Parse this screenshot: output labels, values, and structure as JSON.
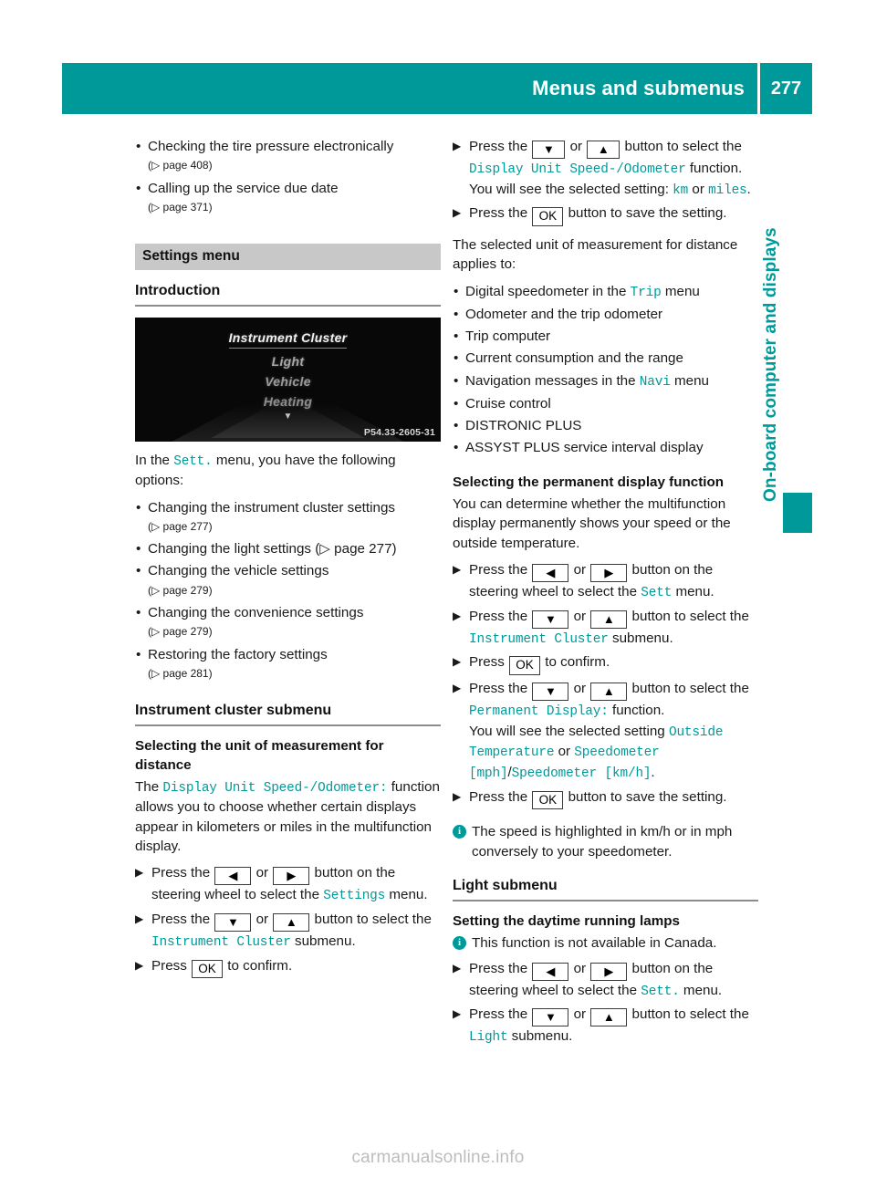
{
  "header": {
    "title": "Menus and submenus",
    "page_number": "277",
    "accent_color": "#009999"
  },
  "side_tab": {
    "label": "On-board computer and displays"
  },
  "watermark": {
    "text": "carmanualsonline.info"
  },
  "left_column": {
    "intro_bullets": [
      {
        "bullet": "•",
        "text": "Checking the tire pressure electronically",
        "ref": "(▷ page 408)"
      },
      {
        "bullet": "•",
        "text": "Calling up the service due date",
        "ref": "(▷ page 371)"
      }
    ],
    "section_band": "Settings menu",
    "introduction_heading": "Introduction",
    "cluster_image": {
      "items": [
        "Instrument Cluster",
        "Light",
        "Vehicle",
        "Heating"
      ],
      "scroll_arrow": "▼",
      "code": "P54.33-2605-31"
    },
    "intro_lead_pre": "In the ",
    "intro_lead_mono": "Sett.",
    "intro_lead_post": " menu, you have the following options:",
    "option_bullets": [
      {
        "bullet": "•",
        "text": "Changing the instrument cluster settings",
        "ref": "(▷ page 277)",
        "inline": false
      },
      {
        "bullet": "•",
        "text": "Changing the light settings (▷ page 277)",
        "ref": "",
        "inline": true
      },
      {
        "bullet": "•",
        "text": "Changing the vehicle settings",
        "ref": "(▷ page 279)",
        "inline": false
      },
      {
        "bullet": "•",
        "text": "Changing the convenience settings",
        "ref": "(▷ page 279)",
        "inline": false
      },
      {
        "bullet": "•",
        "text": "Restoring the factory settings",
        "ref": "(▷ page 281)",
        "inline": false
      }
    ],
    "submenu_heading": "Instrument cluster submenu",
    "unit_heading": "Selecting the unit of measurement for distance",
    "unit_para_pre": "The ",
    "unit_para_mono": "Display Unit Speed-/Odometer:",
    "unit_para_post": " function allows you to choose whether certain displays appear in kilometers or miles in the multifunction display.",
    "steps": [
      {
        "marker": "▶",
        "pre": "Press the ",
        "btn1": "◀",
        "mid": " or ",
        "btn2": "▶",
        "post": " button on the steering wheel to select the ",
        "mono": "Settings",
        "tail": " menu."
      },
      {
        "marker": "▶",
        "pre": "Press the ",
        "btn1": "▼",
        "mid": " or ",
        "btn2": "▲",
        "post": " button to select the ",
        "mono": "Instrument Cluster",
        "tail": " submenu."
      },
      {
        "marker": "▶",
        "pre": "Press ",
        "btn_ok": "OK",
        "post": " to confirm."
      }
    ]
  },
  "right_column": {
    "step_select_display_unit": {
      "marker": "▶",
      "pre": "Press the ",
      "btn1": "▼",
      "mid": " or ",
      "btn2": "▲",
      "post": " button to select the ",
      "mono": "Display Unit Speed-/Odometer",
      "tail": " function.",
      "sub_pre": "You will see the selected setting: ",
      "sub_mono1": "km",
      "sub_mid": " or ",
      "sub_mono2": "miles",
      "sub_tail": "."
    },
    "step_save": {
      "marker": "▶",
      "pre": "Press the ",
      "btn_ok": "OK",
      "post": " button to save the setting."
    },
    "applies_lead": "The selected unit of measurement for distance applies to:",
    "applies_bullets": [
      {
        "bullet": "•",
        "pre": "Digital speedometer in the ",
        "mono": "Trip",
        "post": " menu"
      },
      {
        "bullet": "•",
        "pre": "Odometer and the trip odometer",
        "mono": "",
        "post": ""
      },
      {
        "bullet": "•",
        "pre": "Trip computer",
        "mono": "",
        "post": ""
      },
      {
        "bullet": "•",
        "pre": "Current consumption and the range",
        "mono": "",
        "post": ""
      },
      {
        "bullet": "•",
        "pre": "Navigation messages in the ",
        "mono": "Navi",
        "post": " menu"
      },
      {
        "bullet": "•",
        "pre": "Cruise control",
        "mono": "",
        "post": ""
      },
      {
        "bullet": "•",
        "pre": "DISTRONIC PLUS",
        "mono": "",
        "post": ""
      },
      {
        "bullet": "•",
        "pre": "ASSYST PLUS service interval display",
        "mono": "",
        "post": ""
      }
    ],
    "permanent_heading": "Selecting the permanent display function",
    "permanent_para": "You can determine whether the multifunction display permanently shows your speed or the outside temperature.",
    "permanent_steps": [
      {
        "marker": "▶",
        "pre": "Press the ",
        "btn1": "◀",
        "mid": " or ",
        "btn2": "▶",
        "post": " button on the steering wheel to select the ",
        "mono": "Sett",
        "tail": " menu."
      },
      {
        "marker": "▶",
        "pre": "Press the ",
        "btn1": "▼",
        "mid": " or ",
        "btn2": "▲",
        "post": " button to select the ",
        "mono": "Instrument Cluster",
        "tail": " submenu."
      },
      {
        "marker": "▶",
        "pre": "Press ",
        "btn_ok": "OK",
        "post": " to confirm."
      }
    ],
    "step_permanent_display": {
      "marker": "▶",
      "pre": "Press the ",
      "btn1": "▼",
      "mid": " or ",
      "btn2": "▲",
      "post": " button to select the ",
      "mono": "Permanent Display:",
      "tail": " function.",
      "sub_pre": "You will see the selected setting ",
      "sub_mono1": "Outside Temperature",
      "sub_mid": " or ",
      "sub_mono2": "Speedometer [mph]",
      "sub_slash": "/",
      "sub_mono3": "Speedometer [km/h]",
      "sub_tail": "."
    },
    "step_save2": {
      "marker": "▶",
      "pre": "Press the ",
      "btn_ok": "OK",
      "post": " button to save the setting."
    },
    "note_speed": "The speed is highlighted in km/h or in mph conversely to your speedometer.",
    "light_heading": "Light submenu",
    "daytime_heading": "Setting the daytime running lamps",
    "note_canada": "This function is not available in Canada.",
    "light_steps": [
      {
        "marker": "▶",
        "pre": "Press the ",
        "btn1": "◀",
        "mid": " or ",
        "btn2": "▶",
        "post": " button on the steering wheel to select the ",
        "mono": "Sett.",
        "tail": " menu."
      },
      {
        "marker": "▶",
        "pre": "Press the ",
        "btn1": "▼",
        "mid": " or ",
        "btn2": "▲",
        "post": " button to select the ",
        "mono": "Light",
        "tail": " submenu."
      }
    ]
  }
}
